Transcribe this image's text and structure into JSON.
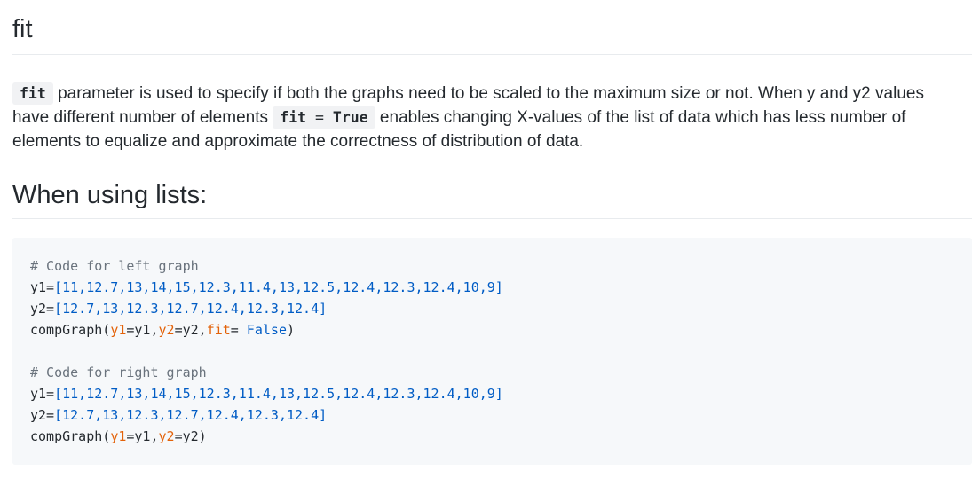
{
  "section_title": "fit",
  "paragraph": {
    "code1": "fit",
    "text1": " parameter is used to specify if both the graphs need to be scaled to the maximum size or not. When y and y2 values have different number of elements ",
    "code2_name": "fit",
    "code2_op": " = ",
    "code2_value": "True",
    "text2": " enables changing X-values of the list of data which has less number of elements to equalize and approximate the correctness of distribution of data."
  },
  "subheading": "When using lists:",
  "code": {
    "left_comment": "# Code for left graph",
    "left_y1_var": "y1=",
    "left_y1_values": "[11,12.7,13,14,15,12.3,11.4,13,12.5,12.4,12.3,12.4,10,9]",
    "left_y2_var": "y2=",
    "left_y2_values": "[12.7,13,12.3,12.7,12.4,12.3,12.4]",
    "left_call_fn": "compGraph(",
    "left_call_arg1": "y1",
    "left_call_eq1": "=y1,",
    "left_call_arg2": "y2",
    "left_call_eq2": "=y2,",
    "left_call_arg3": "fit",
    "left_call_eq3": "= ",
    "left_call_val3": "False",
    "left_call_end": ")",
    "right_comment": "# Code for right graph",
    "right_y1_var": "y1=",
    "right_y1_values": "[11,12.7,13,14,15,12.3,11.4,13,12.5,12.4,12.3,12.4,10,9]",
    "right_y2_var": "y2=",
    "right_y2_values": "[12.7,13,12.3,12.7,12.4,12.3,12.4]",
    "right_call_fn": "compGraph(",
    "right_call_arg1": "y1",
    "right_call_eq1": "=y1,",
    "right_call_arg2": "y2",
    "right_call_eq2": "=y2",
    "right_call_end": ")"
  },
  "colors": {
    "text": "#24292e",
    "comment": "#6a737d",
    "number": "#005cc5",
    "keyword_arg": "#e36209",
    "code_bg": "#f6f8fa",
    "inline_code_bg": "#f1f2f4",
    "rule": "#e8ebee"
  }
}
